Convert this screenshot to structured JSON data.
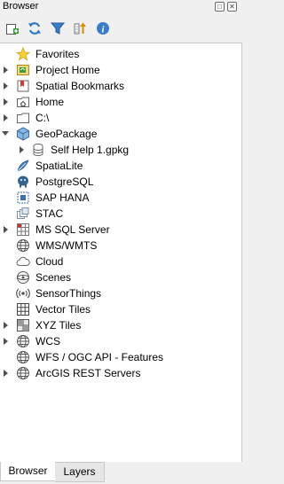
{
  "window": {
    "title": "Browser"
  },
  "toolbar": {
    "buttons": [
      {
        "icon": "add-layer-icon"
      },
      {
        "icon": "refresh-icon"
      },
      {
        "icon": "filter-icon"
      },
      {
        "icon": "collapse-all-icon"
      },
      {
        "icon": "info-icon"
      }
    ]
  },
  "tree": {
    "items": [
      {
        "label": "Favorites",
        "icon": "star-icon",
        "expandable": false
      },
      {
        "label": "Project Home",
        "icon": "project-home-icon",
        "expandable": true
      },
      {
        "label": "Spatial Bookmarks",
        "icon": "spatial-bookmarks-icon",
        "expandable": true
      },
      {
        "label": "Home",
        "icon": "home-folder-icon",
        "expandable": true
      },
      {
        "label": "C:\\",
        "icon": "folder-icon",
        "expandable": true
      },
      {
        "label": "GeoPackage",
        "icon": "geopackage-icon",
        "expandable": true,
        "expanded": true
      },
      {
        "label": "Self Help 1.gpkg",
        "icon": "database-icon",
        "expandable": true,
        "child": true
      },
      {
        "label": "SpatiaLite",
        "icon": "spatialite-icon",
        "expandable": false
      },
      {
        "label": "PostgreSQL",
        "icon": "postgresql-icon",
        "expandable": false
      },
      {
        "label": "SAP HANA",
        "icon": "sap-hana-icon",
        "expandable": false
      },
      {
        "label": "STAC",
        "icon": "stac-icon",
        "expandable": false
      },
      {
        "label": "MS SQL Server",
        "icon": "mssql-icon",
        "expandable": true
      },
      {
        "label": "WMS/WMTS",
        "icon": "globe-icon",
        "expandable": false
      },
      {
        "label": "Cloud",
        "icon": "cloud-icon",
        "expandable": false
      },
      {
        "label": "Scenes",
        "icon": "scenes-icon",
        "expandable": false
      },
      {
        "label": "SensorThings",
        "icon": "sensorthings-icon",
        "expandable": false
      },
      {
        "label": "Vector Tiles",
        "icon": "vector-tiles-icon",
        "expandable": false
      },
      {
        "label": "XYZ Tiles",
        "icon": "xyz-tiles-icon",
        "expandable": true
      },
      {
        "label": "WCS",
        "icon": "globe-icon",
        "expandable": true
      },
      {
        "label": "WFS / OGC API - Features",
        "icon": "globe-icon",
        "expandable": false
      },
      {
        "label": "ArcGIS REST Servers",
        "icon": "globe-icon",
        "expandable": true
      }
    ]
  },
  "tabs": [
    {
      "label": "Browser",
      "active": true
    },
    {
      "label": "Layers",
      "active": false
    }
  ],
  "colors": {
    "selected_tab_bg": "#ffffff",
    "panel_border": "#c9c9c9",
    "qgis_green": "#3a9d3a"
  }
}
